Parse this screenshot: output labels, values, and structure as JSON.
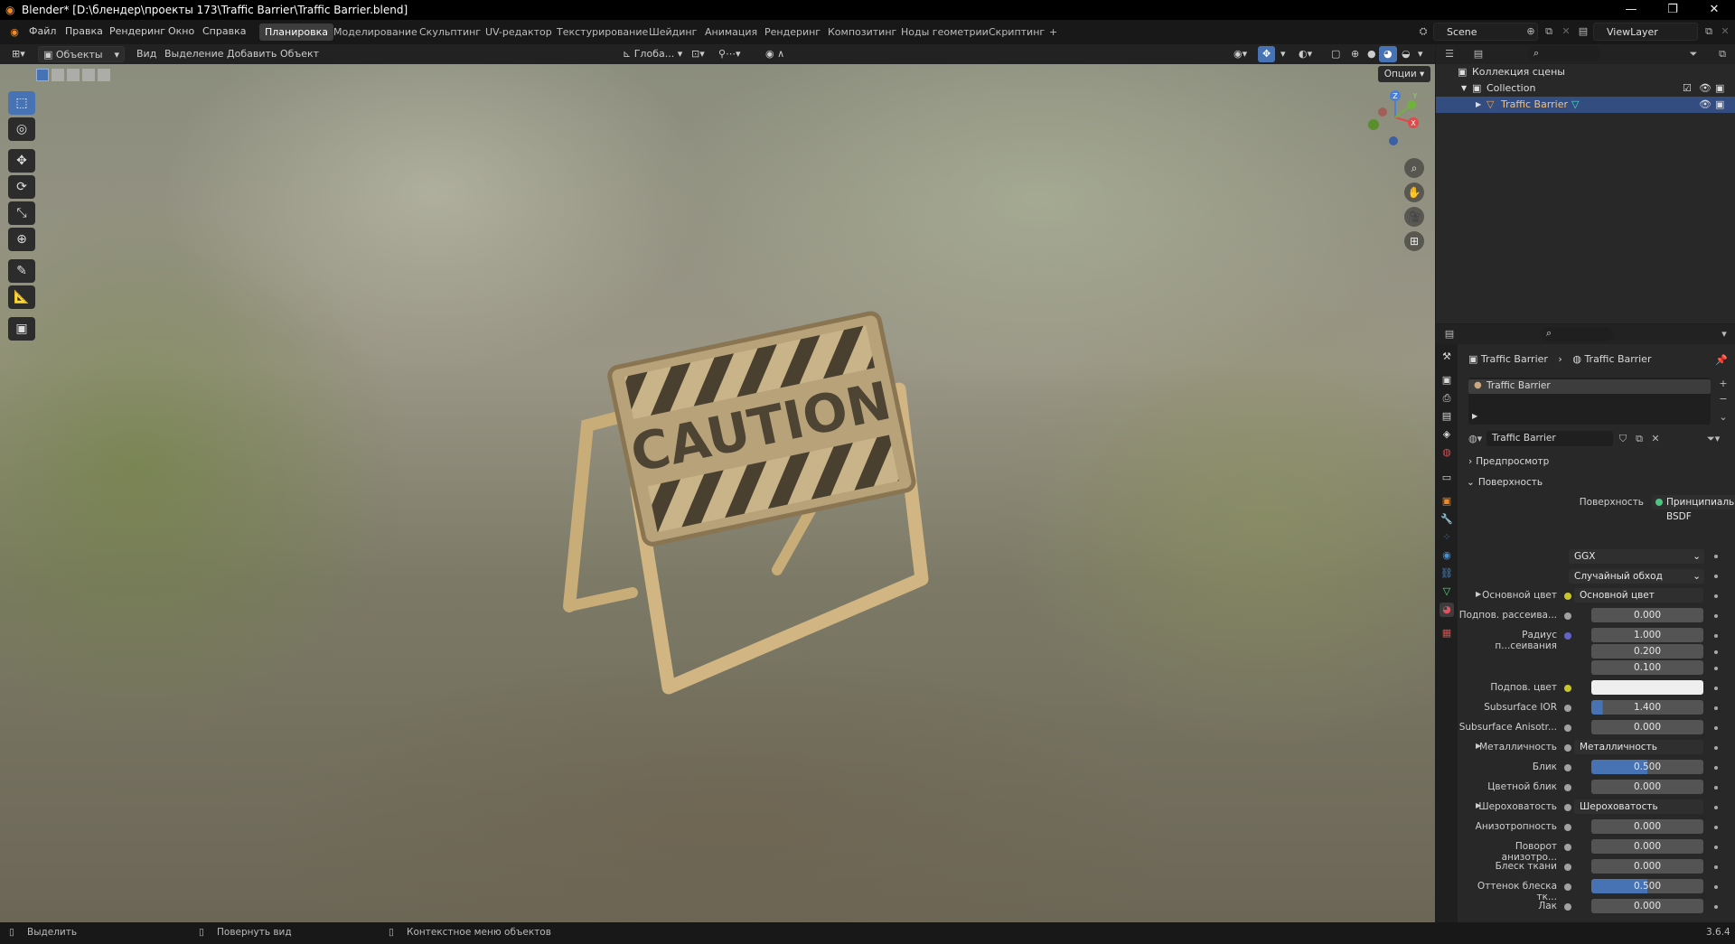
{
  "window": {
    "title": "Blender* [D:\\блендер\\проекты 173\\Traffic Barrier\\Traffic Barrier.blend]",
    "minimize": "—",
    "maximize": "❐",
    "close": "✕"
  },
  "menu": [
    "Файл",
    "Правка",
    "Рендеринг",
    "Окно",
    "Справка"
  ],
  "workspaces": [
    "Планировка",
    "Моделирование",
    "Скульптинг",
    "UV-редактор",
    "Текстурирование",
    "Шейдинг",
    "Анимация",
    "Рендеринг",
    "Композитинг",
    "Ноды геометрии",
    "Скриптинг",
    "+"
  ],
  "active_workspace": "Планировка",
  "scene": "Scene",
  "view_layer": "ViewLayer",
  "viewport_header": {
    "mode": "Объекты",
    "items": [
      "Вид",
      "Выделение",
      "Добавить",
      "Объект"
    ],
    "transform": "Глоба...",
    "options": "Опции"
  },
  "viewport": {
    "caution_text": "CAUTION",
    "gizmo": {
      "x": "X",
      "y": "Y",
      "z": "Z"
    }
  },
  "outliner": {
    "scene_collection": "Коллекция сцены",
    "collection": "Collection",
    "object": "Traffic Barrier"
  },
  "properties": {
    "breadcrumb": [
      "Traffic Barrier",
      "Traffic Barrier"
    ],
    "material_slot": "Traffic Barrier",
    "material_name": "Traffic Barrier",
    "panels": {
      "preview": "Предпросмотр",
      "surface": "Поверхность"
    },
    "surface_label": "Поверхность",
    "surface_value": "Принципиальный BSDF",
    "distribution": "GGX",
    "subsurface_method": "Случайный обход",
    "rows": [
      {
        "label": "Основной цвет",
        "value": "Основной цвет",
        "kind": "link",
        "dot": "#c7c729",
        "fill": 0
      },
      {
        "label": "Подпов. рассеива...",
        "value": "0.000",
        "kind": "num",
        "dot": "#a1a1a1",
        "fill": 0
      },
      {
        "label": "Радиус п...сеивания",
        "value": "1.000",
        "kind": "num",
        "dot": "#6363c7",
        "fill": 0
      },
      {
        "label": "",
        "value": "0.200",
        "kind": "num",
        "dot": "",
        "fill": 0
      },
      {
        "label": "",
        "value": "0.100",
        "kind": "num",
        "dot": "",
        "fill": 0
      },
      {
        "label": "Подпов. цвет",
        "value": "",
        "kind": "color",
        "dot": "#c7c729",
        "fill": 0
      },
      {
        "label": "Subsurface IOR",
        "value": "1.400",
        "kind": "num",
        "dot": "#a1a1a1",
        "fill": 0.1
      },
      {
        "label": "Subsurface Anisotr...",
        "value": "0.000",
        "kind": "num",
        "dot": "#a1a1a1",
        "fill": 0
      },
      {
        "label": "Металличность",
        "value": "Металличность",
        "kind": "link",
        "dot": "#a1a1a1",
        "fill": 0
      },
      {
        "label": "Блик",
        "value": "0.500",
        "kind": "num",
        "dot": "#a1a1a1",
        "fill": 0.5
      },
      {
        "label": "Цветной блик",
        "value": "0.000",
        "kind": "num",
        "dot": "#a1a1a1",
        "fill": 0
      },
      {
        "label": "Шероховатость",
        "value": "Шероховатость",
        "kind": "link",
        "dot": "#a1a1a1",
        "fill": 0
      },
      {
        "label": "Анизотропность",
        "value": "0.000",
        "kind": "num",
        "dot": "#a1a1a1",
        "fill": 0
      },
      {
        "label": "Поворот анизотро...",
        "value": "0.000",
        "kind": "num",
        "dot": "#a1a1a1",
        "fill": 0
      },
      {
        "label": "Блеск ткани",
        "value": "0.000",
        "kind": "num",
        "dot": "#a1a1a1",
        "fill": 0
      },
      {
        "label": "Оттенок блеска тк...",
        "value": "0.500",
        "kind": "num",
        "dot": "#a1a1a1",
        "fill": 0.5
      },
      {
        "label": "Лак",
        "value": "0.000",
        "kind": "num",
        "dot": "#a1a1a1",
        "fill": 0
      }
    ]
  },
  "statusbar": {
    "select": "Выделить",
    "rotate": "Повернуть вид",
    "context": "Контекстное меню объектов",
    "version": "3.6.4"
  },
  "colors": {
    "accent_blue": "#4772b3",
    "selection": "#334d80",
    "blender_orange": "#f08a24"
  }
}
